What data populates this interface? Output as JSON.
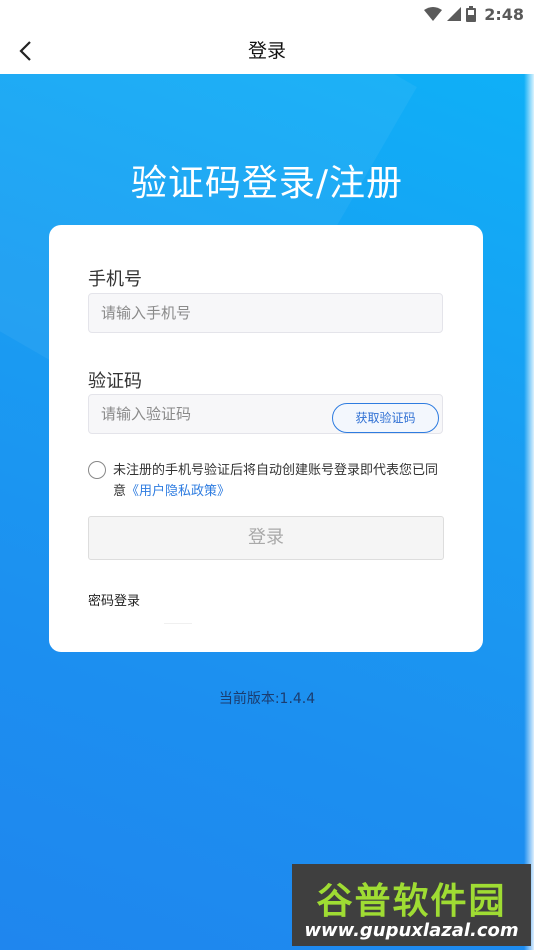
{
  "status_bar": {
    "time": "2:48",
    "icons": [
      "wifi-icon",
      "signal-icon",
      "battery-icon"
    ]
  },
  "nav": {
    "title": "登录",
    "back_icon": "chevron-left-icon"
  },
  "hero": {
    "title": "验证码登录/注册"
  },
  "form": {
    "phone_label": "手机号",
    "phone_placeholder": "请输入手机号",
    "code_label": "验证码",
    "code_placeholder": "请输入验证码",
    "get_code_label": "获取验证码",
    "agreement_text": "未注册的手机号验证后将自动创建账号登录即代表您已同意",
    "agreement_link": "《用户隐私政策》",
    "login_label": "登录",
    "password_login_label": "密码登录"
  },
  "version": "当前版本:1.4.4",
  "watermark": {
    "name": "谷普软件园",
    "url": "www.gupuxlazal.com"
  },
  "colors": {
    "accent": "#2e7ce0",
    "hero_top": "#0fb0f7",
    "hero_bottom": "#1f86ee"
  }
}
